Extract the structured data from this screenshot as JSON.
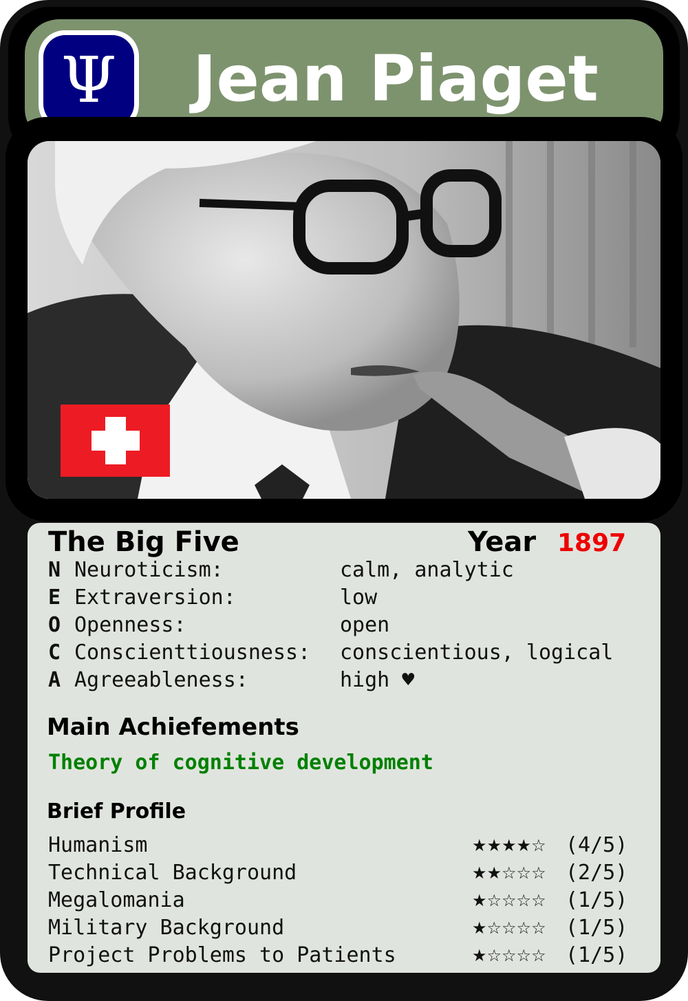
{
  "card": {
    "name": "Jean Piaget",
    "logo_symbol": "Ψ",
    "flag_icon": "swiss-flag-icon",
    "colors": {
      "header": "#7d936e",
      "logo": "#000080",
      "flag": "#ed1c24",
      "year": "#ee0000",
      "achievement": "#008000",
      "panel": "#e0e4de"
    }
  },
  "big_five": {
    "heading": "The Big Five",
    "year_label": "Year",
    "year_value": "1897",
    "traits": [
      {
        "letter": "N",
        "label": "Neuroticism:",
        "value": "calm, analytic"
      },
      {
        "letter": "E",
        "label": "Extraversion:",
        "value": "low"
      },
      {
        "letter": "O",
        "label": "Openness:",
        "value": "open"
      },
      {
        "letter": "C",
        "label": "Conscienttiousness:",
        "value": "conscientious, logical"
      },
      {
        "letter": "A",
        "label": "Agreeableness:",
        "value": "high ♥"
      }
    ]
  },
  "achievements": {
    "heading": "Main Achiefements",
    "text": "Theory of cognitive development"
  },
  "profile": {
    "heading": "Brief Profile",
    "rows": [
      {
        "label": "Humanism",
        "stars": "★★★★☆",
        "score": "(4/5)",
        "rating": 4
      },
      {
        "label": "Technical Background",
        "stars": "★★☆☆☆",
        "score": "(2/5)",
        "rating": 2
      },
      {
        "label": "Megalomania",
        "stars": "★☆☆☆☆",
        "score": "(1/5)",
        "rating": 1
      },
      {
        "label": "Military Background",
        "stars": "★☆☆☆☆",
        "score": "(1/5)",
        "rating": 1
      },
      {
        "label": "Project Problems to Patients",
        "stars": "★☆☆☆☆",
        "score": "(1/5)",
        "rating": 1
      }
    ]
  }
}
